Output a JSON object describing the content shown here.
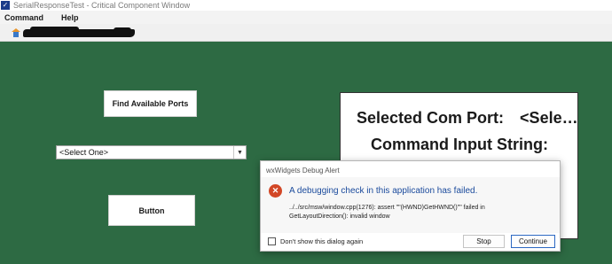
{
  "window": {
    "title": "SerialResponseTest - Critical Component Window"
  },
  "menu": {
    "items": [
      "Command",
      "Help"
    ]
  },
  "main": {
    "find_ports_label": "Find Available Ports",
    "select_value": "<Select One>",
    "button_label": "Button"
  },
  "panel": {
    "selected_label": "Selected Com Port:",
    "selected_value": "<Sele…",
    "command_label": "Command Input String:"
  },
  "dialog": {
    "title": "wxWidgets Debug Alert",
    "heading": "A debugging check in this application has failed.",
    "message": "../../src/msw/window.cpp(1276): assert \"\"(HWND)GetHWND()\"\" failed in GetLayoutDirection(): invalid window",
    "checkbox_label": "Don't show this dialog again",
    "stop_label": "Stop",
    "continue_label": "Continue"
  },
  "colors": {
    "background": "#2d6a43",
    "dialog_heading": "#1a4a9c",
    "error_icon": "#d24726"
  }
}
